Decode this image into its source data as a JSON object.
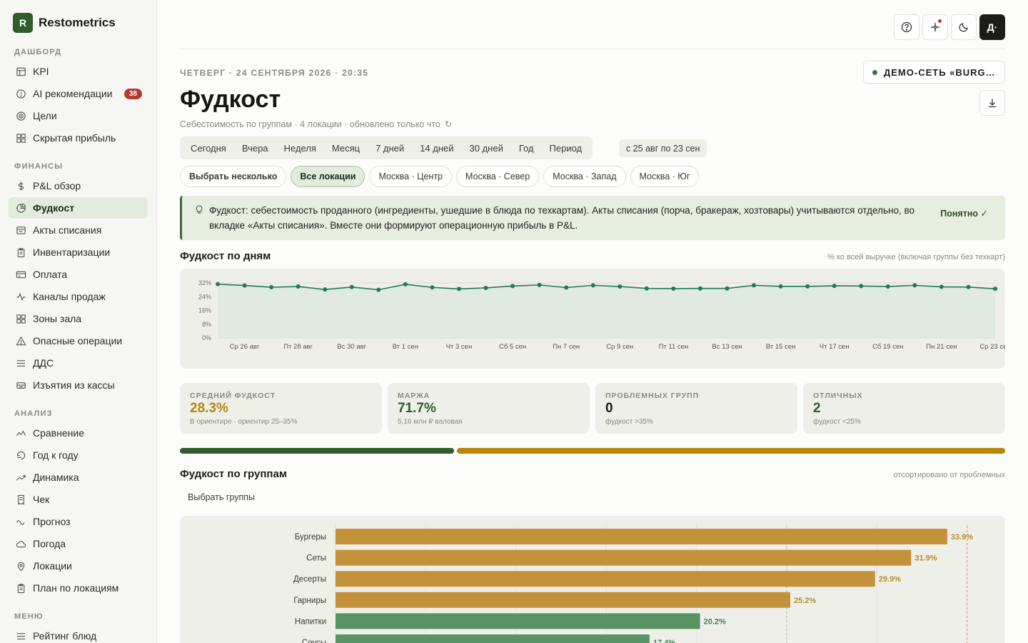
{
  "brand": {
    "logo_letter": "R",
    "name": "Restometrics"
  },
  "sidebar": {
    "sections": [
      {
        "title": "ДАШБОРД",
        "items": [
          {
            "label": "KPI",
            "icon": "table-icon"
          },
          {
            "label": "AI рекомендации",
            "icon": "alert-circle-icon",
            "badge": "38"
          },
          {
            "label": "Цели",
            "icon": "target-icon"
          },
          {
            "label": "Скрытая прибыль",
            "icon": "grid-icon"
          }
        ]
      },
      {
        "title": "ФИНАНСЫ",
        "items": [
          {
            "label": "P&L обзор",
            "icon": "dollar-icon"
          },
          {
            "label": "Фудкост",
            "icon": "pie-icon",
            "active": true
          },
          {
            "label": "Акты списания",
            "icon": "doc-icon"
          },
          {
            "label": "Инвентаризации",
            "icon": "clipboard-icon"
          },
          {
            "label": "Оплата",
            "icon": "card-icon"
          },
          {
            "label": "Каналы продаж",
            "icon": "pulse-icon"
          },
          {
            "label": "Зоны зала",
            "icon": "grid-icon"
          },
          {
            "label": "Опасные операции",
            "icon": "warning-icon"
          },
          {
            "label": "ДДС",
            "icon": "list-icon"
          },
          {
            "label": "Изъятия из кассы",
            "icon": "register-icon"
          }
        ]
      },
      {
        "title": "АНАЛИЗ",
        "items": [
          {
            "label": "Сравнение",
            "icon": "compare-icon"
          },
          {
            "label": "Год к году",
            "icon": "yoy-icon"
          },
          {
            "label": "Динамика",
            "icon": "trend-icon"
          },
          {
            "label": "Чек",
            "icon": "receipt-icon"
          },
          {
            "label": "Прогноз",
            "icon": "wave-icon"
          },
          {
            "label": "Погода",
            "icon": "cloud-icon"
          },
          {
            "label": "Локации",
            "icon": "pin-icon"
          },
          {
            "label": "План по локациям",
            "icon": "clipboard-icon"
          }
        ]
      },
      {
        "title": "МЕНЮ",
        "items": [
          {
            "label": "Рейтинг блюд",
            "icon": "list-icon"
          }
        ]
      }
    ]
  },
  "top": {
    "avatar": "Д·"
  },
  "header": {
    "datetime": "ЧЕТВЕРГ · 24 СЕНТЯБРЯ 2026 · 20:35",
    "network": "ДЕМО-СЕТЬ «BURGER HOUSE»",
    "title": "Фудкост",
    "subtitle": "Себестоимость по группам · 4 локации · обновлено только что",
    "refresh_glyph": "↻"
  },
  "periods": [
    "Сегодня",
    "Вчера",
    "Неделя",
    "Месяц",
    "7 дней",
    "14 дней",
    "30 дней",
    "Год",
    "Период"
  ],
  "range": "с 25 авг по 23 сен",
  "locations": {
    "multi": "Выбрать несколько",
    "items": [
      "Все локации",
      "Москва · Центр",
      "Москва · Север",
      "Москва · Запад",
      "Москва · Юг"
    ],
    "active": 0
  },
  "banner": {
    "text": "Фудкост: себестоимость проданного (ингредиенты, ушедшие в блюда по техкартам). Акты списания (порча, бракераж, хозтовары) учитываются отдельно, во вкладке «Акты списания». Вместе они формируют операционную прибыль в P&L.",
    "ok": "Понятно ✓"
  },
  "daily": {
    "title": "Фудкост по дням",
    "note": "% ко всей выручке (включая группы без техкарт)"
  },
  "kpis": [
    {
      "label": "СРЕДНИЙ ФУДКОСТ",
      "value": "28.3%",
      "hint": "В ориентире · ориентир 25–35%",
      "color": "#b8860b"
    },
    {
      "label": "МАРЖА",
      "value": "71.7%",
      "hint": "5,16 млн ₽ валовая",
      "color": "#2f5d2c"
    },
    {
      "label": "ПРОБЛЕМНЫХ ГРУПП",
      "value": "0",
      "hint": "фудкост >35%",
      "color": "#1c1c1a"
    },
    {
      "label": "ОТЛИЧНЫХ",
      "value": "2",
      "hint": "фудкост <25%",
      "color": "#2f5d2c"
    }
  ],
  "progress": {
    "good_fraction": 0.333,
    "good_color": "#2f5d2c",
    "warn_color": "#b8860b"
  },
  "groups": {
    "title": "Фудкост по группам",
    "note": "отсортировано от проблемных",
    "select": "Выбрать группы"
  },
  "chart_data": [
    {
      "type": "line",
      "x": [
        "Вт 25 авг",
        "Ср 26 авг",
        "Чт 27 авг",
        "Пт 28 авг",
        "Сб 29 авг",
        "Вс 30 авг",
        "Пн 31 авг",
        "Вт 1 сен",
        "Ср 2 сен",
        "Чт 3 сен",
        "Пт 4 сен",
        "Сб 5 сен",
        "Вс 6 сен",
        "Пн 7 сен",
        "Вт 8 сен",
        "Ср 9 сен",
        "Чт 10 сен",
        "Пт 11 сен",
        "Сб 12 сен",
        "Вс 13 сен",
        "Пн 14 сен",
        "Вт 15 сен",
        "Ср 16 сен",
        "Чт 17 сен",
        "Пт 18 сен",
        "Сб 19 сен",
        "Вс 20 сен",
        "Пн 21 сен",
        "Вт 22 сен",
        "Ср 23 сен"
      ],
      "tick_labels": [
        "Ср 26 авг",
        "Пт 28 авг",
        "Вс 30 авг",
        "Вт 1 сен",
        "Чт 3 сен",
        "Сб 5 сен",
        "Пн 7 сен",
        "Ср 9 сен",
        "Пт 11 сен",
        "Вс 13 сен",
        "Вт 15 сен",
        "Чт 17 сен",
        "Сб 19 сен",
        "Пн 21 сен",
        "Ср 23 сен"
      ],
      "values": [
        31.3,
        30.5,
        29.5,
        29.9,
        28.2,
        29.6,
        28.0,
        31.2,
        29.4,
        28.5,
        29.1,
        30.2,
        30.8,
        29.3,
        30.6,
        29.9,
        28.8,
        28.7,
        28.8,
        28.8,
        30.6,
        30.0,
        30.0,
        30.3,
        30.2,
        29.9,
        30.6,
        29.7,
        29.6,
        28.6
      ],
      "yticks": [
        "0%",
        "8%",
        "16%",
        "24%",
        "32%"
      ],
      "ylim": [
        0,
        32
      ],
      "color": "#1f7a5a"
    },
    {
      "type": "bar",
      "categories": [
        "Бургеры",
        "Сеты",
        "Десерты",
        "Гарниры",
        "Напитки",
        "Соусы"
      ],
      "values": [
        33.9,
        31.9,
        29.9,
        25.2,
        20.2,
        17.4
      ],
      "labels": [
        "33.9%",
        "31.9%",
        "29.9%",
        "25.2%",
        "20.2%",
        "17.4%"
      ],
      "xlim": [
        0,
        36
      ],
      "reference_lines": [
        25,
        35
      ],
      "warn_color": "#c3923a",
      "good_color": "#589463"
    }
  ]
}
